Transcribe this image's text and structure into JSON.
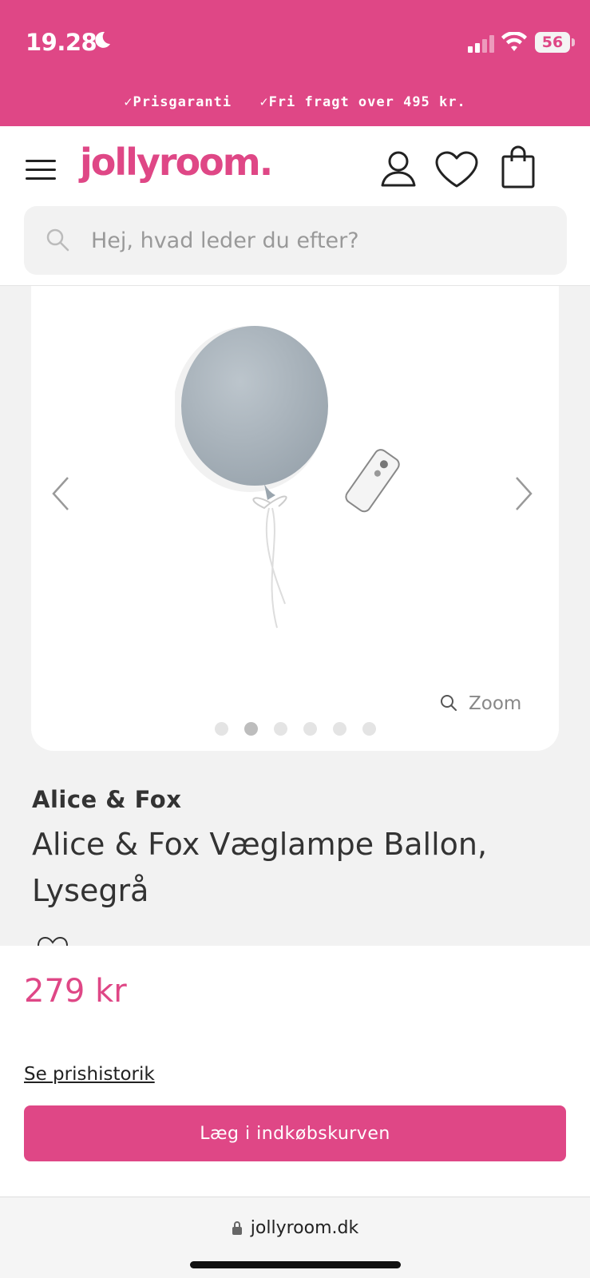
{
  "status_bar": {
    "time": "19.28",
    "battery": "56"
  },
  "promo": {
    "item1": "✓Prisgaranti",
    "item2": "✓Fri fragt over 495 kr."
  },
  "header": {
    "logo": "jollyroom."
  },
  "search": {
    "placeholder": "Hej, hvad leder du efter?"
  },
  "gallery": {
    "zoom_label": "Zoom",
    "dot_count": 6,
    "active_dot": 2
  },
  "product": {
    "brand": "Alice & Fox",
    "title": "Alice & Fox Væglampe Ballon, Lysegrå"
  },
  "buy": {
    "price": "279 kr",
    "price_history": "Se prishistorik",
    "add_to_cart": "Læg i indkøbskurven"
  },
  "browser": {
    "url": "jollyroom.dk"
  },
  "colors": {
    "brand_pink": "#df4786",
    "balloon": "#aab4bd"
  }
}
